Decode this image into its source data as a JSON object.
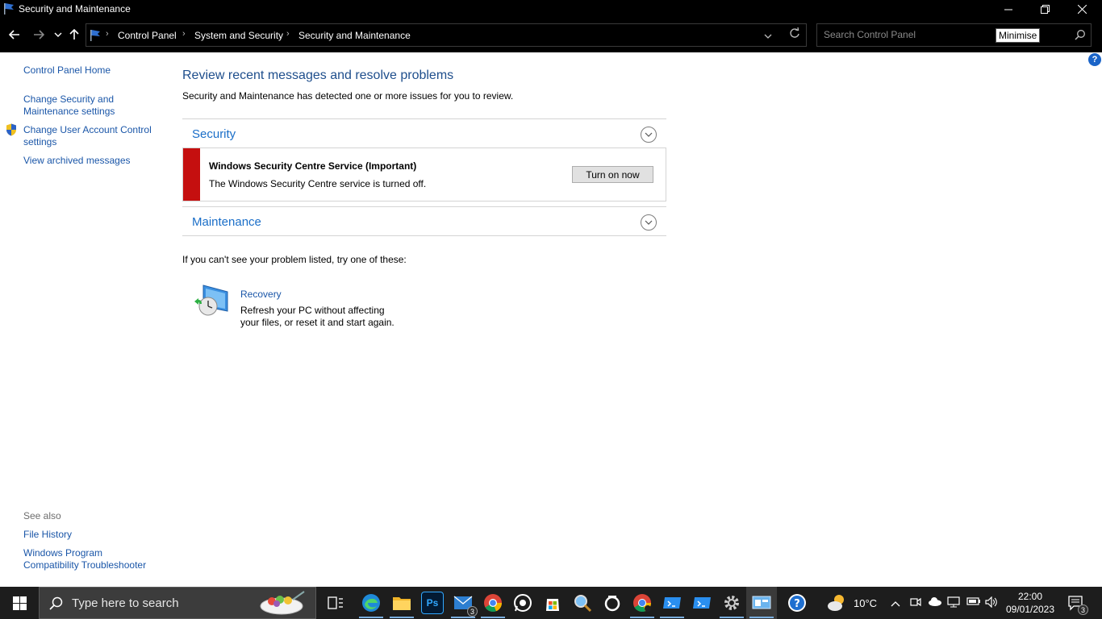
{
  "window": {
    "title": "Security and Maintenance",
    "tooltip": "Minimise"
  },
  "address": {
    "breadcrumbs": [
      "Control Panel",
      "System and Security",
      "Security and Maintenance"
    ],
    "search_placeholder": "Search Control Panel"
  },
  "sidebar": {
    "links": [
      "Control Panel Home",
      "Change Security and Maintenance settings",
      "Change User Account Control settings",
      "View archived messages"
    ],
    "see_also_label": "See also",
    "see_also": [
      "File History",
      "Windows Program Compatibility Troubleshooter"
    ]
  },
  "main": {
    "title": "Review recent messages and resolve problems",
    "subtitle": "Security and Maintenance has detected one or more issues for you to review.",
    "sections": {
      "security": "Security",
      "maintenance": "Maintenance"
    },
    "alert": {
      "title": "Windows Security Centre Service (Important)",
      "message": "The Windows Security Centre service is turned off.",
      "button": "Turn on now"
    },
    "try_text": "If you can't see your problem listed, try one of these:",
    "recovery": {
      "title": "Recovery",
      "desc": "Refresh your PC without affecting your files, or reset it and start again."
    }
  },
  "taskbar": {
    "search_placeholder": "Type here to search",
    "mail_badge": "3",
    "temperature": "10°C",
    "time": "22:00",
    "date": "09/01/2023",
    "notification_count": "3"
  },
  "colors": {
    "link": "#1a56a8",
    "title_blue": "#1e4e8c",
    "section_blue": "#1a6ec8",
    "alert_red": "#c50f0f",
    "taskbar": "#1d1d1d"
  }
}
